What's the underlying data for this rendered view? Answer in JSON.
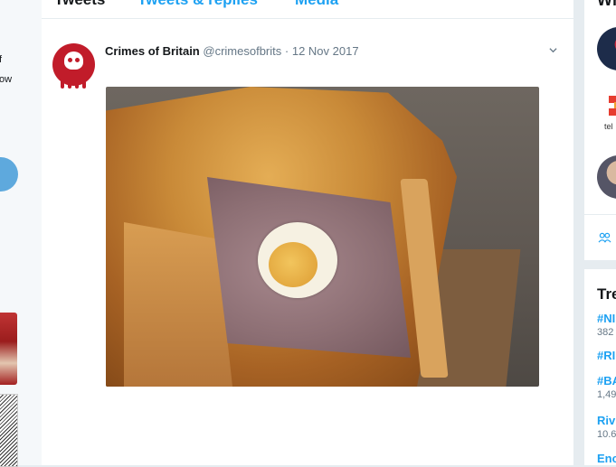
{
  "left": {
    "fragments": [
      "f",
      "ow"
    ]
  },
  "profile_tabs": [
    {
      "label": "Tweets"
    },
    {
      "label": "Tweets & replies"
    },
    {
      "label": "Media"
    }
  ],
  "tweet": {
    "author_name": "Crimes of Britain",
    "author_handle": "@crimesofbrits",
    "separator": "·",
    "date": "12 Nov 2017",
    "avatar_icon": "skull-icon",
    "menu_icon": "chevron-down-icon",
    "media_description_icon": "photo"
  },
  "sidebar_right": {
    "who_to_follow_title": "Wh",
    "who_to_follow_av2_label": "tel",
    "people_icon": "people-icon",
    "trends_title": "Tre",
    "trends": [
      {
        "name": "#NI",
        "count": "382"
      },
      {
        "name": "#RI",
        "count": ""
      },
      {
        "name": "#BA",
        "count": "1,49"
      },
      {
        "name": "Riv",
        "count": "10.6"
      },
      {
        "name": "Enc",
        "count": ""
      }
    ]
  },
  "colors": {
    "accent": "#1da1f2",
    "page_bg": "#e6ecf0",
    "avatar_red": "#c11c2a",
    "muted": "#657786"
  }
}
